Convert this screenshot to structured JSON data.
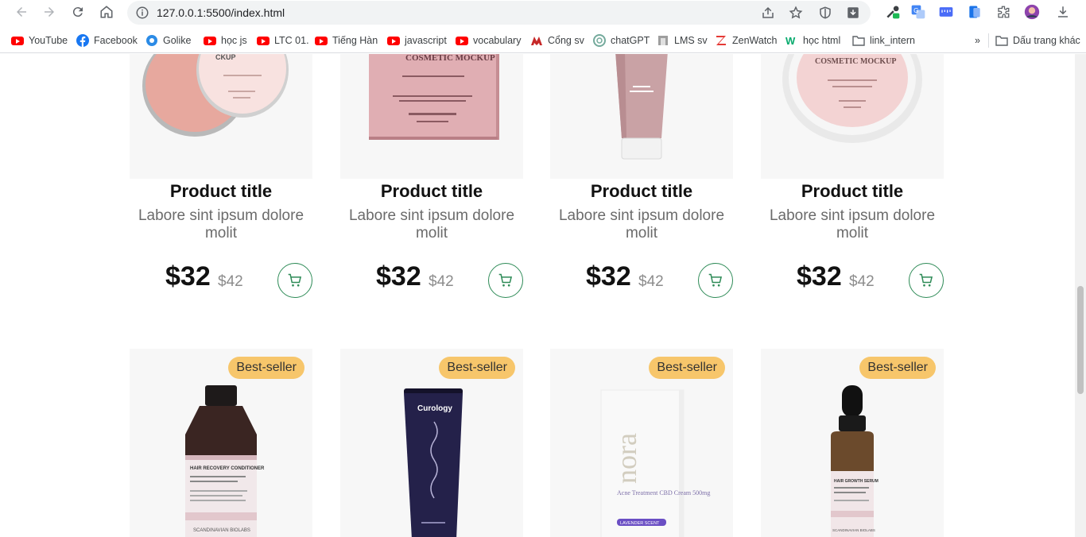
{
  "browser": {
    "url": "127.0.0.1:5500/index.html",
    "bookmarks": [
      {
        "label": "YouTube",
        "icon": "youtube-icon"
      },
      {
        "label": "Facebook",
        "icon": "facebook-icon"
      },
      {
        "label": "Golike",
        "icon": "golike-icon"
      },
      {
        "label": "học js",
        "icon": "youtube-icon"
      },
      {
        "label": "LTC 01.",
        "icon": "youtube-icon"
      },
      {
        "label": "Tiếng Hàn",
        "icon": "youtube-icon"
      },
      {
        "label": "javascript",
        "icon": "youtube-icon"
      },
      {
        "label": "vocabulary",
        "icon": "youtube-icon"
      },
      {
        "label": "Cổng sv",
        "icon": "university-icon"
      },
      {
        "label": "chatGPT",
        "icon": "openai-icon"
      },
      {
        "label": "LMS sv",
        "icon": "lms-icon"
      },
      {
        "label": "ZenWatch",
        "icon": "zenwatch-icon"
      },
      {
        "label": "học html",
        "icon": "w3schools-icon"
      },
      {
        "label": "link_intern",
        "icon": "folder-icon"
      }
    ],
    "more_bookmarks_label": "»",
    "other_bookmarks_label": "Dấu trang khác"
  },
  "products_row1": [
    {
      "title": "Product title",
      "description": "Labore sint ipsum dolore molit",
      "price": "$32",
      "old_price": "$42",
      "image": "pink-cream-tin"
    },
    {
      "title": "Product title",
      "description": "Labore sint ipsum dolore molit",
      "price": "$32",
      "old_price": "$42",
      "image": "pink-cosmetic-box",
      "image_text": "COSMETIC MOCKUP"
    },
    {
      "title": "Product title",
      "description": "Labore sint ipsum dolore molit",
      "price": "$32",
      "old_price": "$42",
      "image": "pink-tube"
    },
    {
      "title": "Product title",
      "description": "Labore sint ipsum dolore molit",
      "price": "$32",
      "old_price": "$42",
      "image": "pink-cream-jar",
      "image_text": "COSMETIC MOCKUP"
    }
  ],
  "products_row2": [
    {
      "badge": "Best-seller",
      "image": "conditioner-bottle",
      "image_text": "HAIR RECOVERY CONDITIONER",
      "image_brand": "SCANDINAVIAN BIOLABS"
    },
    {
      "badge": "Best-seller",
      "image": "curology-tube",
      "image_text": "Curology"
    },
    {
      "badge": "Best-seller",
      "image": "nora-box",
      "image_text": "nora",
      "image_sub": "Acne Treatment CBD Cream 500mg",
      "image_tag": "LAVENDER SCENT"
    },
    {
      "badge": "Best-seller",
      "image": "serum-dropper",
      "image_text": "HAIR GROWTH SERUM",
      "image_brand": "SCANDINAVIAN BIOLABS"
    }
  ],
  "colors": {
    "accent_green": "#2e8b57",
    "badge_yellow": "#f7c66b",
    "image_bg": "#f7f7f7"
  }
}
